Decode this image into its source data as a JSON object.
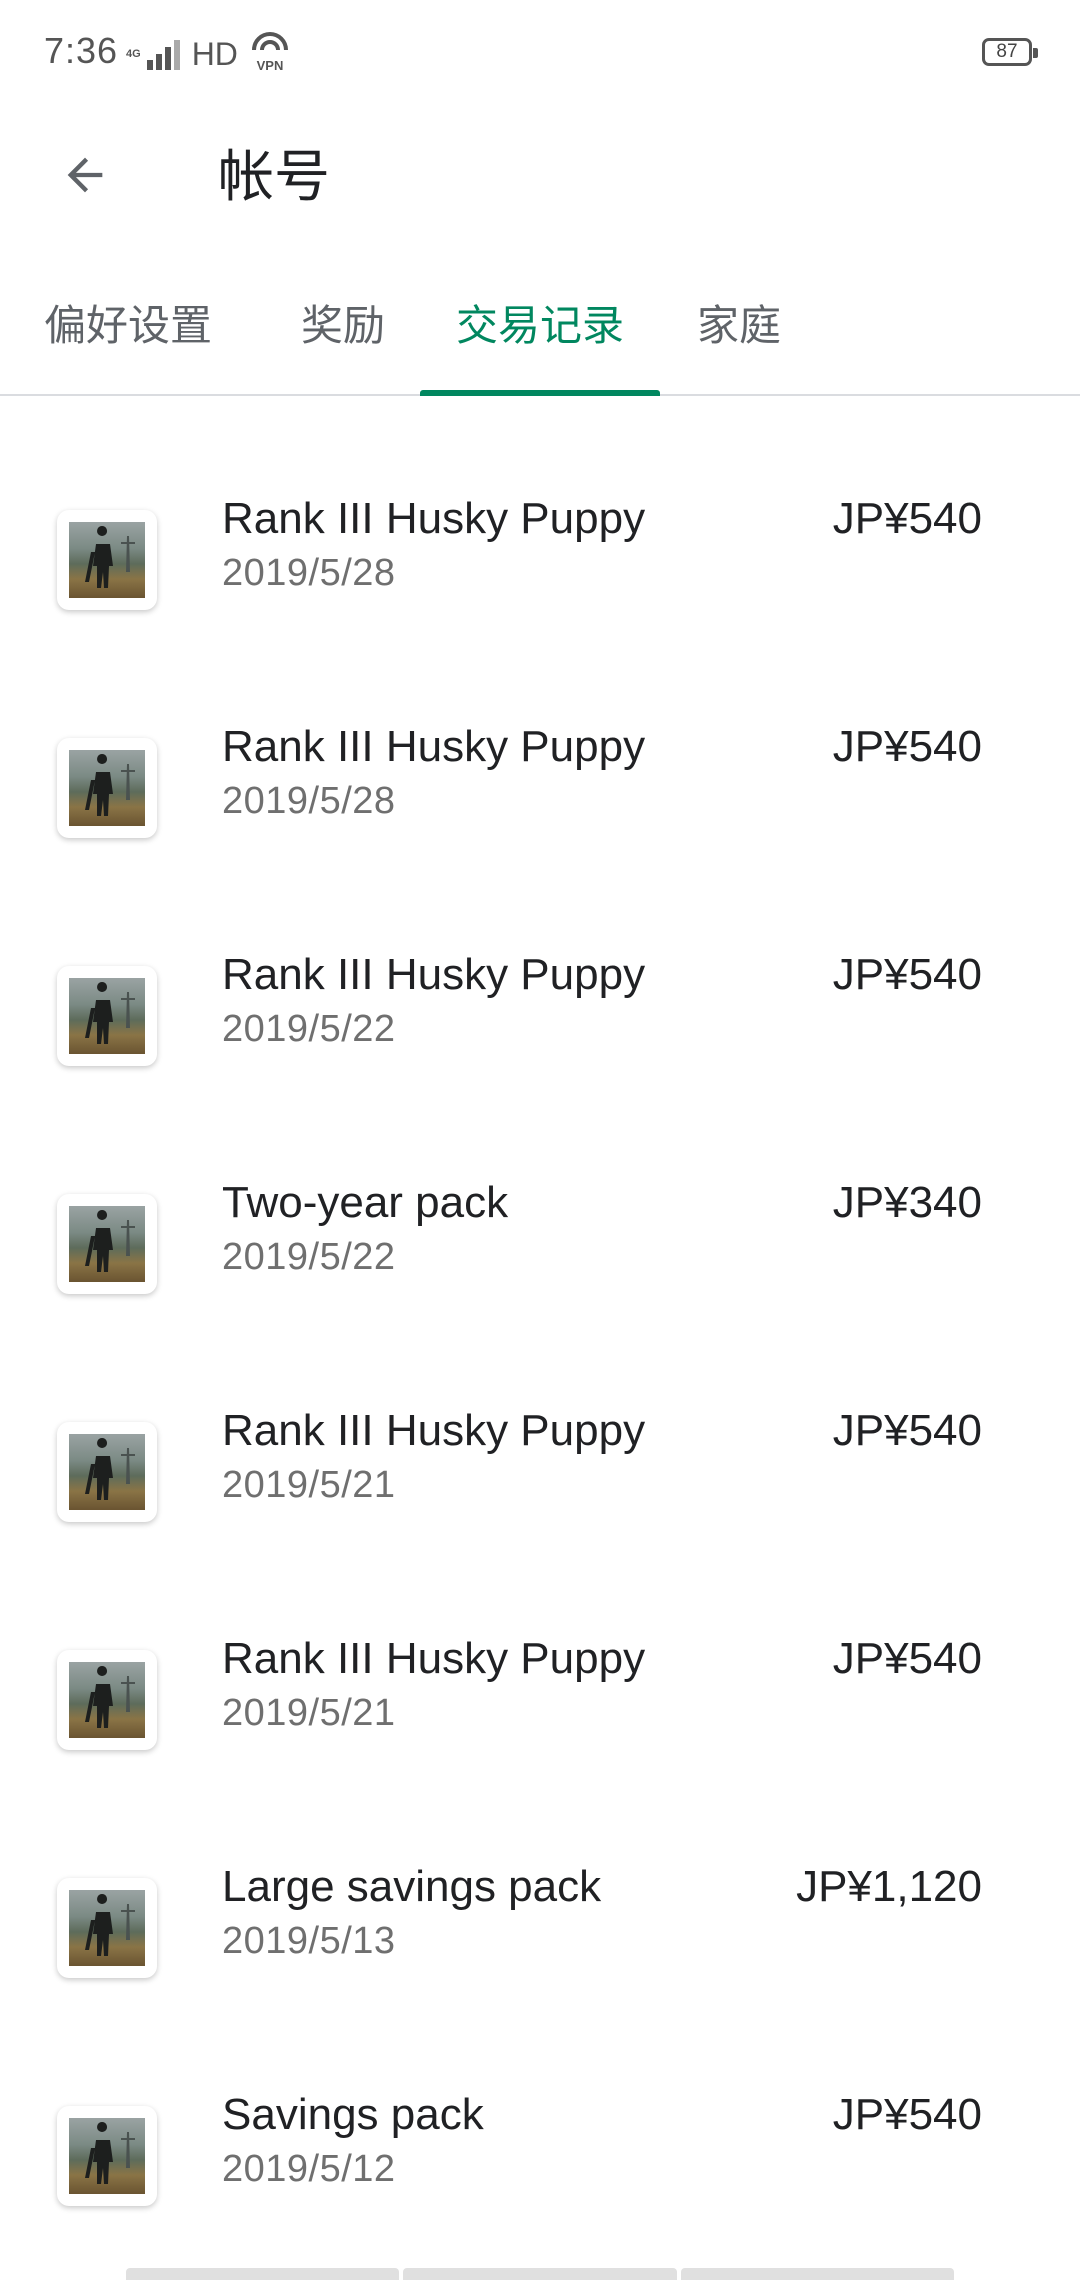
{
  "status_bar": {
    "time": "7:36",
    "network": "4G",
    "hd": "HD",
    "vpn": "VPN",
    "battery": "87"
  },
  "header": {
    "title": "帐号",
    "back_icon": "arrow-back-icon"
  },
  "tabs": [
    {
      "label": "偏好设置",
      "active": false
    },
    {
      "label": "奖励",
      "active": false
    },
    {
      "label": "交易记录",
      "active": true
    },
    {
      "label": "家庭",
      "active": false
    }
  ],
  "colors": {
    "accent": "#01875f",
    "text_primary": "#202124",
    "text_secondary": "#6f6f6f",
    "divider": "#dadce0"
  },
  "transactions": [
    {
      "name": "Rank III Husky Puppy",
      "date": "2019/5/28",
      "price": "JP¥540"
    },
    {
      "name": "Rank III Husky Puppy",
      "date": "2019/5/28",
      "price": "JP¥540"
    },
    {
      "name": "Rank III Husky Puppy",
      "date": "2019/5/22",
      "price": "JP¥540"
    },
    {
      "name": "Two-year pack",
      "date": "2019/5/22",
      "price": "JP¥340"
    },
    {
      "name": "Rank III Husky Puppy",
      "date": "2019/5/21",
      "price": "JP¥540"
    },
    {
      "name": "Rank III Husky Puppy",
      "date": "2019/5/21",
      "price": "JP¥540"
    },
    {
      "name": "Large savings pack",
      "date": "2019/5/13",
      "price": "JP¥1,120"
    },
    {
      "name": "Savings pack",
      "date": "2019/5/12",
      "price": "JP¥540"
    }
  ]
}
